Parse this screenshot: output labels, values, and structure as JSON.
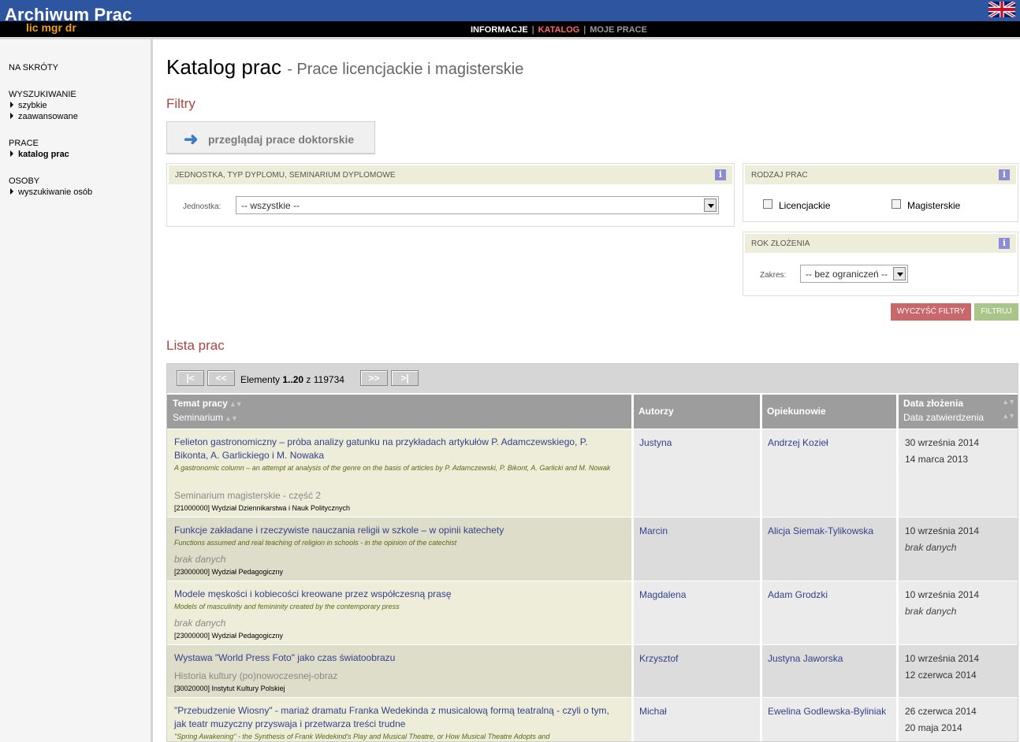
{
  "header": {
    "logo_title": "Archiwum Prac",
    "logo_sub": "lic mgr dr",
    "nav": {
      "info": "INFORMACJE",
      "katalog": "KATALOG",
      "moje": "MOJE  PRACE",
      "sep": "|"
    },
    "flag_icon": "uk-flag-icon"
  },
  "sidebar": {
    "shortcuts": "NA SKRÓTY",
    "search_head": "WYSZUKIWANIE",
    "search_fast": "szybkie",
    "search_adv": "zaawansowane",
    "works_head": "PRACE",
    "works_catalog": "katalog prac",
    "people_head": "OSOBY",
    "people_search": "wyszukiwanie osób"
  },
  "main": {
    "title": "Katalog prac",
    "subtitle": "- Prace licencjackie i magisterskie",
    "filters_title": "Filtry",
    "doc_button": "przeglądaj prace doktorskie",
    "panel_unit": {
      "head": "JEDNOSTKA, TYP DYPLOMU, SEMINARIUM DYPLOMOWE",
      "label": "Jednostka:",
      "value": "-- wszystkie --"
    },
    "panel_type": {
      "head": "RODZAJ PRAC",
      "opt1": "Licencjackie",
      "opt2": "Magisterskie"
    },
    "panel_year": {
      "head": "ROK ZŁOŻENIA",
      "label": "Zakres:",
      "value": "-- bez ograniczeń --"
    },
    "btn_clear": "WYCZYŚĆ FILTRY",
    "btn_filter": "FILTRUJ",
    "list_title": "Lista prac"
  },
  "pager": {
    "first": "|<",
    "prev": "<<",
    "next": ">>",
    "last": ">|",
    "prefix": "Elementy",
    "range": "1..20",
    "of": "z",
    "total": "119734"
  },
  "columns": {
    "topic": "Temat pracy",
    "seminar": "Seminarium",
    "authors": "Autorzy",
    "supervisors": "Opiekunowie",
    "date_submitted": "Data złożenia",
    "date_approved": "Data zatwierdzenia",
    "sort_arrows": "▲▼"
  },
  "rows": [
    {
      "title": "Felieton gastronomiczny – próba analizy gatunku na przykładach artykułów P. Adamczewskiego, P. Bikonta, A. Garlickiego i M. Nowaka",
      "title_en": "A gastronomic column – an attempt at analysis of the genre on the basis of articles by P. Adamczewski, P. Bikont, A. Garlicki and M. Nowak",
      "seminar": "Seminarium magisterskie - część 2",
      "unit": "[21000000] Wydział Dziennikarstwa i Nauk Politycznych",
      "author": "Justyna",
      "supervisor": "Andrzej Kozieł",
      "date1": "30 września 2014",
      "date2": "14 marca 2013"
    },
    {
      "title": "Funkcje zakładane i rzeczywiste nauczania religii w szkole – w opinii katechety",
      "title_en": "Functions assumed and real teaching of religion in schools - in the opinion of the catechist",
      "seminar": "brak danych",
      "unit": "[23000000] Wydział Pedagogiczny",
      "author": "Marcin",
      "supervisor": "Alicja Siemak-Tylikowska",
      "date1": "10 września 2014",
      "date2": "brak danych"
    },
    {
      "title": "Modele męskości i kobiecości kreowane przez współczesną prasę",
      "title_en": "Models of masculinity and femininity created by the contemporary press",
      "seminar": "brak danych",
      "unit": "[23000000] Wydział Pedagogiczny",
      "author": "Magdalena",
      "supervisor": "Adam Grodzki",
      "date1": "10 września 2014",
      "date2": "brak danych"
    },
    {
      "title": "Wystawa \"World Press Foto\" jako czas światoobrazu",
      "seminar": "Historia kultury (po)nowoczesnej-obraz",
      "unit": "[30020000] Instytut Kultury Polskiej",
      "author": "Krzysztof",
      "supervisor": "Justyna Jaworska",
      "date1": "10 września 2014",
      "date2": "12 czerwca 2014"
    },
    {
      "title": "\"Przebudzenie Wiosny\" - mariaż dramatu Franka Wedekinda z musicalową formą teatralną - czyli o tym, jak teatr muzyczny przyswaja i przetwarza treści trudne",
      "title_en": "\"Spring Awakening\" - the Synthesis of Frank Wedekind's Play and Musical Theatre, or How Musical Theatre Adopts and",
      "author": "Michał",
      "supervisor": "Ewelina Godlewska-Byliniak",
      "date1": "26 czerwca 2014",
      "date2": "20 maja 2014"
    }
  ]
}
